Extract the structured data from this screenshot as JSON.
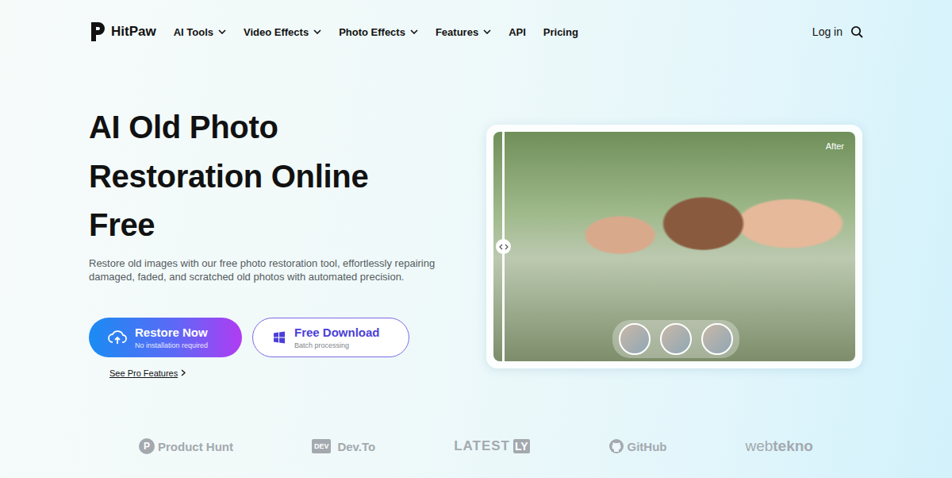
{
  "brand": {
    "name": "HitPaw"
  },
  "nav": [
    {
      "label": "AI Tools",
      "has_menu": true
    },
    {
      "label": "Video Effects",
      "has_menu": true
    },
    {
      "label": "Photo Effects",
      "has_menu": true
    },
    {
      "label": "Features",
      "has_menu": true
    },
    {
      "label": "API",
      "has_menu": false
    },
    {
      "label": "Pricing",
      "has_menu": false
    }
  ],
  "account": {
    "login": "Log in"
  },
  "hero": {
    "title_lines": [
      "AI Old Photo",
      "Restoration Online",
      "Free"
    ],
    "description": "Restore old images with our free photo restoration tool, effortlessly repairing damaged, faded, and scratched old photos with automated precision.",
    "primary_button": {
      "label": "Restore Now",
      "sub": "No installation required"
    },
    "secondary_button": {
      "label": "Free Download",
      "sub": "Batch processing"
    },
    "link": "See Pro Features"
  },
  "preview": {
    "badge": "After"
  },
  "logos": [
    {
      "kind": "circle",
      "badge": "P",
      "label": "Product Hunt"
    },
    {
      "kind": "box",
      "badge": "DEV",
      "label": "Dev.To"
    },
    {
      "kind": "suffix",
      "label": "LATEST",
      "badge": "LY"
    },
    {
      "kind": "github",
      "label": "GitHub"
    },
    {
      "kind": "split",
      "label": "web",
      "badge": "tekno"
    }
  ]
}
